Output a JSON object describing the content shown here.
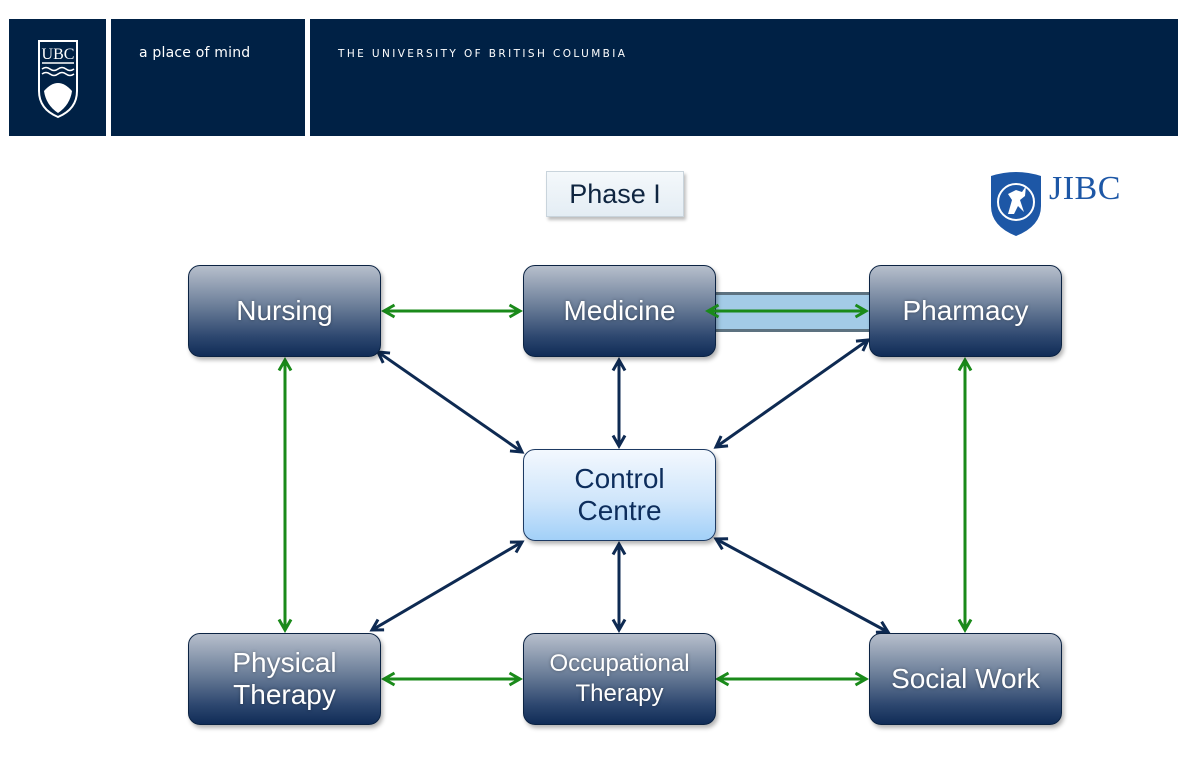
{
  "header": {
    "logo": "ubc-crest",
    "logo_text": "UBC",
    "tagline": "a place of mind",
    "university_name": "THE UNIVERSITY OF BRITISH COLUMBIA"
  },
  "title": "Phase I",
  "partner_logo": {
    "icon": "jibc-shield",
    "text": "JIBC"
  },
  "colors": {
    "banner": "#002145",
    "node_dark": "#102c57",
    "node_center": "#a2d0f8",
    "arrow_navy": "#0e2a52",
    "arrow_green": "#1a8a1a",
    "highlight": "#8cbee1"
  },
  "nodes": [
    {
      "id": "nursing",
      "label": "Nursing"
    },
    {
      "id": "medicine",
      "label": "Medicine"
    },
    {
      "id": "pharmacy",
      "label": "Pharmacy"
    },
    {
      "id": "control",
      "label": "Control Centre"
    },
    {
      "id": "pt",
      "label": "Physical Therapy"
    },
    {
      "id": "ot",
      "label": "Occupational Therapy"
    },
    {
      "id": "sw",
      "label": "Social Work"
    }
  ],
  "edges": [
    {
      "from": "nursing",
      "to": "medicine",
      "color": "green"
    },
    {
      "from": "medicine",
      "to": "pharmacy",
      "color": "green",
      "highlighted": true
    },
    {
      "from": "nursing",
      "to": "pt",
      "color": "green"
    },
    {
      "from": "pharmacy",
      "to": "sw",
      "color": "green"
    },
    {
      "from": "pt",
      "to": "ot",
      "color": "green"
    },
    {
      "from": "ot",
      "to": "sw",
      "color": "green"
    },
    {
      "from": "nursing",
      "to": "control",
      "color": "navy"
    },
    {
      "from": "medicine",
      "to": "control",
      "color": "navy"
    },
    {
      "from": "pharmacy",
      "to": "control",
      "color": "navy"
    },
    {
      "from": "pt",
      "to": "control",
      "color": "navy"
    },
    {
      "from": "ot",
      "to": "control",
      "color": "navy"
    },
    {
      "from": "sw",
      "to": "control",
      "color": "navy"
    }
  ]
}
